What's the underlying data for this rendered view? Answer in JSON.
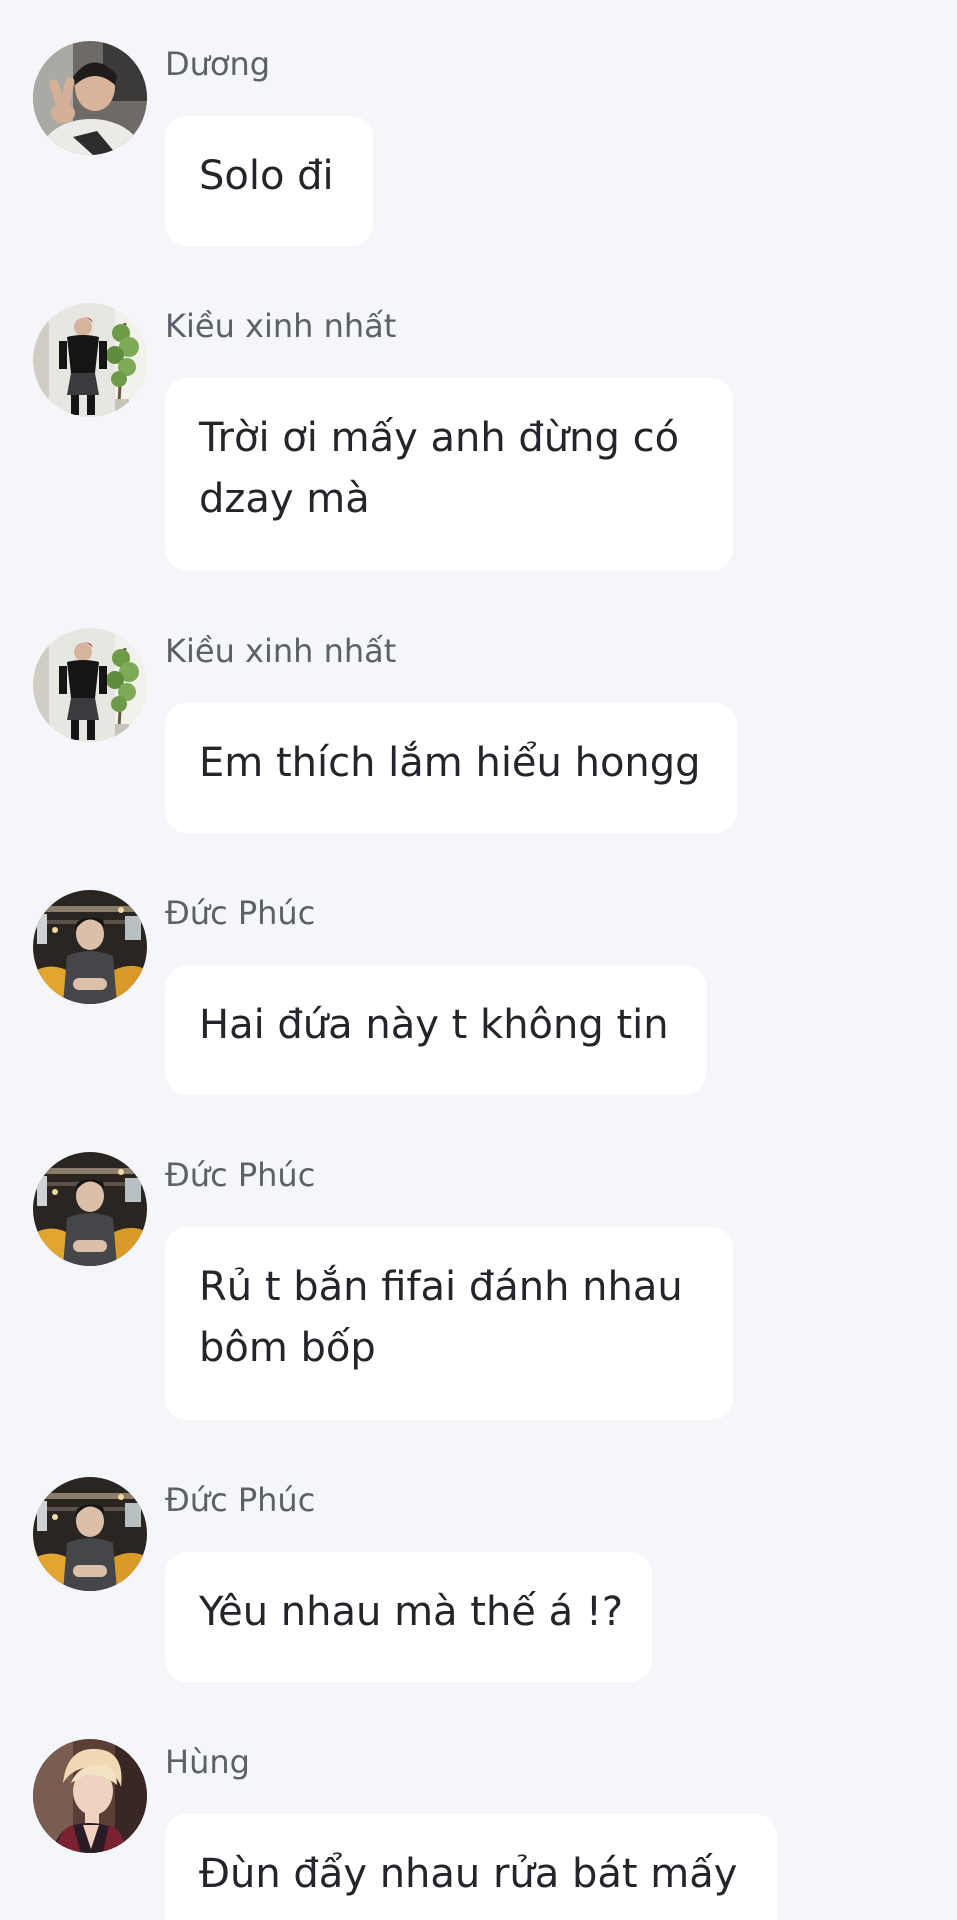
{
  "messages": [
    {
      "sender": "Dương",
      "lines": [
        "Solo đi"
      ],
      "avatar": "duong-avatar"
    },
    {
      "sender": "Kiều xinh nhất",
      "lines": [
        "Trời ơi mấy anh đừng có",
        "dzay mà"
      ],
      "avatar": "kieu-avatar"
    },
    {
      "sender": "Kiều xinh nhất",
      "lines": [
        "Em thích lắm hiểu hongg"
      ],
      "avatar": "kieu-avatar"
    },
    {
      "sender": "Đức Phúc",
      "lines": [
        "Hai đứa này t không tin"
      ],
      "avatar": "duc-phuc-avatar"
    },
    {
      "sender": "Đức Phúc",
      "lines": [
        "Rủ t bắn fifai đánh nhau",
        "bôm bốp"
      ],
      "avatar": "duc-phuc-avatar"
    },
    {
      "sender": "Đức Phúc",
      "lines": [
        "Yêu nhau mà thế á !?"
      ],
      "avatar": "duc-phuc-avatar"
    },
    {
      "sender": "Hùng",
      "lines": [
        "Đùn đẩy nhau rửa bát mấy"
      ],
      "avatar": "hung-avatar"
    }
  ],
  "colors": {
    "background": "#f4f6f9",
    "bubble": "#ffffff",
    "sender_text": "#5d6066",
    "message_text": "#23252a"
  }
}
